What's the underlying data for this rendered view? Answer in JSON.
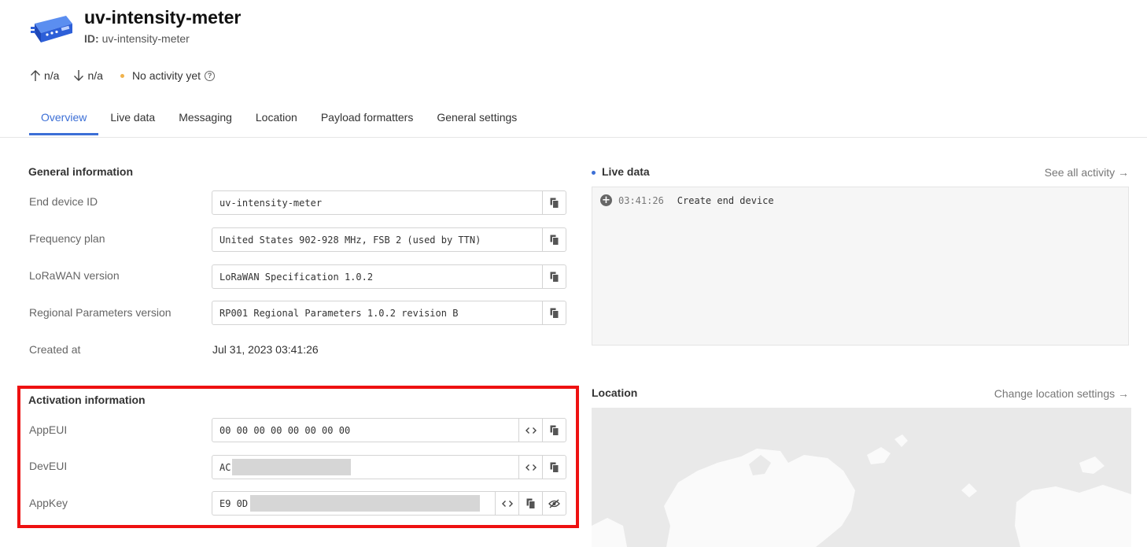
{
  "device": {
    "title": "uv-intensity-meter",
    "id_label": "ID:",
    "id_value": "uv-intensity-meter"
  },
  "stats": {
    "uplink": "n/a",
    "downlink": "n/a",
    "activity": "No activity yet"
  },
  "tabs": [
    {
      "label": "Overview",
      "active": true
    },
    {
      "label": "Live data"
    },
    {
      "label": "Messaging"
    },
    {
      "label": "Location"
    },
    {
      "label": "Payload formatters"
    },
    {
      "label": "General settings"
    }
  ],
  "general": {
    "title": "General information",
    "end_device_id_label": "End device ID",
    "end_device_id_value": "uv-intensity-meter",
    "frequency_plan_label": "Frequency plan",
    "frequency_plan_value": "United States 902-928 MHz, FSB 2 (used by TTN)",
    "lorawan_version_label": "LoRaWAN version",
    "lorawan_version_value": "LoRaWAN Specification 1.0.2",
    "regional_params_label": "Regional Parameters version",
    "regional_params_value": "RP001 Regional Parameters 1.0.2 revision B",
    "created_label": "Created at",
    "created_value": "Jul 31, 2023 03:41:26"
  },
  "activation": {
    "title": "Activation information",
    "appeui_label": "AppEUI",
    "appeui_value": "00 00 00 00 00 00 00 00",
    "deveui_label": "DevEUI",
    "deveui_value": "AC",
    "appkey_label": "AppKey",
    "appkey_value": "E9 0D"
  },
  "live": {
    "title": "Live data",
    "link": "See all activity →",
    "events": [
      {
        "time": "03:41:26",
        "text": "Create end device"
      }
    ]
  },
  "location": {
    "title": "Location",
    "link": "Change location settings →"
  },
  "colors": {
    "accent": "#3c6fd6",
    "highlight": "#ee1111",
    "status_dot": "#f0b24c"
  }
}
